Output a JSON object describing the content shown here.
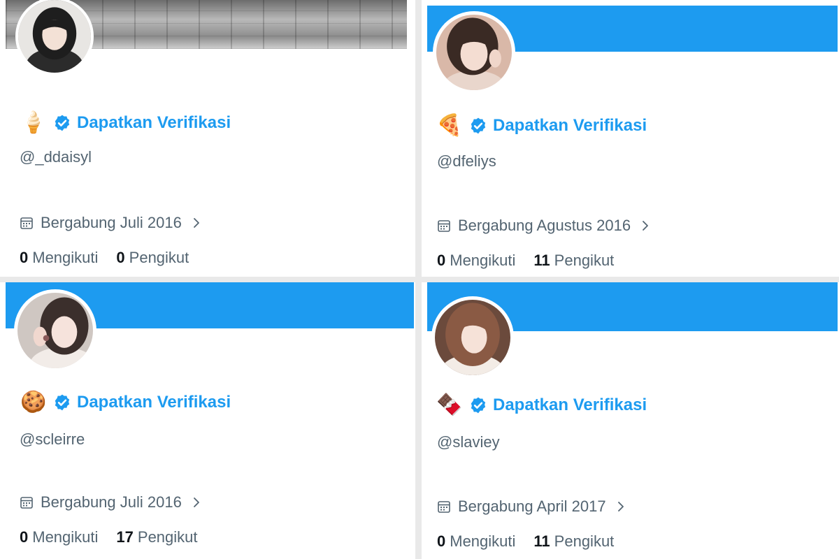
{
  "accent_color": "#1d9bf0",
  "verified_icon": "verified-badge-icon",
  "profiles": [
    {
      "emoji": "🍦",
      "verify_label": "Dapatkan Verifikasi",
      "handle": "@_ddaisyl",
      "joined": "Bergabung Juli 2016",
      "following_count": "0",
      "following_label": "Mengikuti",
      "followers_count": "0",
      "followers_label": "Pengikut"
    },
    {
      "emoji": "🍕",
      "verify_label": "Dapatkan Verifikasi",
      "handle": "@dfeliys",
      "joined": "Bergabung Agustus 2016",
      "following_count": "0",
      "following_label": "Mengikuti",
      "followers_count": "11",
      "followers_label": "Pengikut"
    },
    {
      "emoji": "🍪",
      "verify_label": "Dapatkan Verifikasi",
      "handle": "@scleirre",
      "joined": "Bergabung Juli 2016",
      "following_count": "0",
      "following_label": "Mengikuti",
      "followers_count": "17",
      "followers_label": "Pengikut"
    },
    {
      "emoji": "🍫",
      "verify_label": "Dapatkan Verifikasi",
      "handle": "@slaviey",
      "joined": "Bergabung April 2017",
      "following_count": "0",
      "following_label": "Mengikuti",
      "followers_count": "11",
      "followers_label": "Pengikut"
    }
  ]
}
